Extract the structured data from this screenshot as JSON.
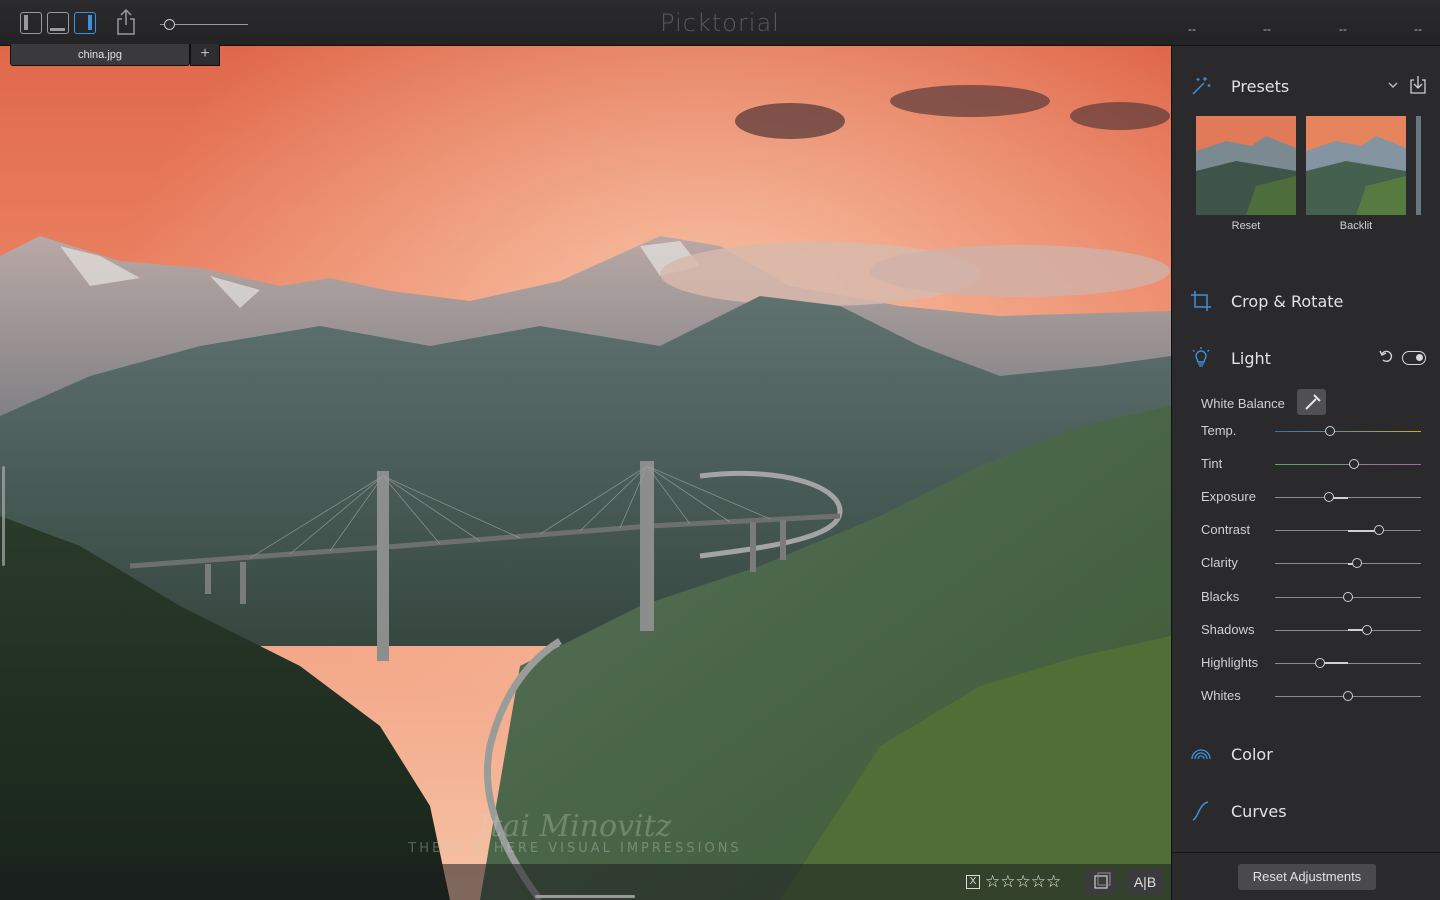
{
  "titlebar": {
    "app_title": "Picktorial",
    "status_dashes": [
      "--",
      "--",
      "--",
      "--"
    ]
  },
  "tabs": {
    "file_name": "china.jpg",
    "add_label": "+"
  },
  "photo": {
    "watermark_name": "Itai Minovitz",
    "watermark_tagline": "THERE & HERE VISUAL IMPRESSIONS"
  },
  "bottom_bar": {
    "stars": "☆☆☆☆☆",
    "flag": "X",
    "ab_label": "A|B"
  },
  "panel": {
    "presets": {
      "title": "Presets",
      "items": [
        {
          "label": "Reset"
        },
        {
          "label": "Backlit"
        }
      ]
    },
    "crop": {
      "title": "Crop & Rotate"
    },
    "light": {
      "title": "Light",
      "white_balance_label": "White Balance",
      "sliders": [
        {
          "label": "Temp.",
          "value": 0.38
        },
        {
          "label": "Tint",
          "value": 0.54
        },
        {
          "label": "Exposure",
          "value": 0.37
        },
        {
          "label": "Contrast",
          "value": 0.71
        },
        {
          "label": "Clarity",
          "value": 0.56
        },
        {
          "label": "Blacks",
          "value": 0.5
        },
        {
          "label": "Shadows",
          "value": 0.63
        },
        {
          "label": "Highlights",
          "value": 0.31
        },
        {
          "label": "Whites",
          "value": 0.5
        }
      ]
    },
    "color": {
      "title": "Color"
    },
    "curves": {
      "title": "Curves"
    },
    "reset_button": "Reset Adjustments"
  },
  "colors": {
    "accent": "#3f8fdc",
    "panel_bg": "#2a2a2c"
  }
}
